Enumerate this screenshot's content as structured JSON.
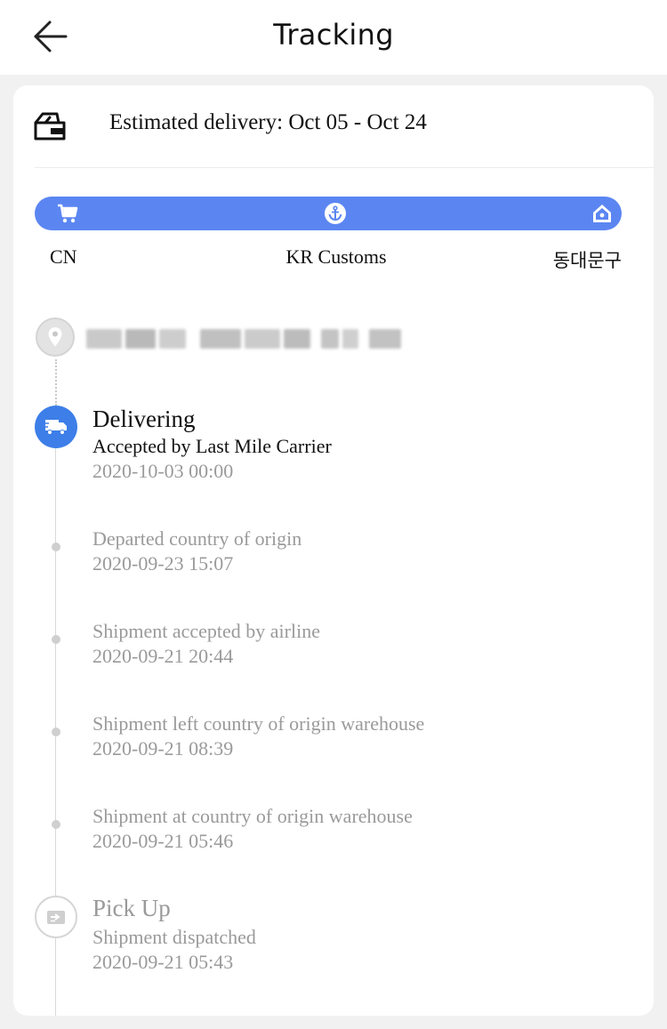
{
  "header": {
    "title": "Tracking",
    "back_icon": "arrow-left-icon"
  },
  "estimate": {
    "icon": "wallet-box-icon",
    "text": "Estimated delivery: Oct 05 - Oct 24"
  },
  "progress": {
    "color": "#5b86f2",
    "stages": [
      {
        "icon": "cart-icon",
        "label": "CN"
      },
      {
        "icon": "anchor-icon",
        "label": "KR Customs"
      },
      {
        "icon": "home-icon",
        "label": "동대문구"
      }
    ]
  },
  "destination": {
    "icon": "location-pin-icon"
  },
  "events": [
    {
      "title": "Delivering",
      "description": "Accepted by Last Mile Carrier",
      "time": "2020-10-03 00:00",
      "icon": "truck-icon",
      "active": true
    },
    {
      "description": "Departed country of origin",
      "time": "2020-09-23 15:07"
    },
    {
      "description": "Shipment accepted by airline",
      "time": "2020-09-21 20:44"
    },
    {
      "description": "Shipment left country of origin warehouse",
      "time": "2020-09-21 08:39"
    },
    {
      "description": "Shipment at country of origin warehouse",
      "time": "2020-09-21 05:46"
    },
    {
      "title": "Pick Up",
      "description": "Shipment dispatched",
      "time": "2020-09-21 05:43",
      "icon": "dispatch-icon"
    }
  ],
  "colors": {
    "accent": "#3d7ee8",
    "muted_text": "#9a9a9a"
  }
}
